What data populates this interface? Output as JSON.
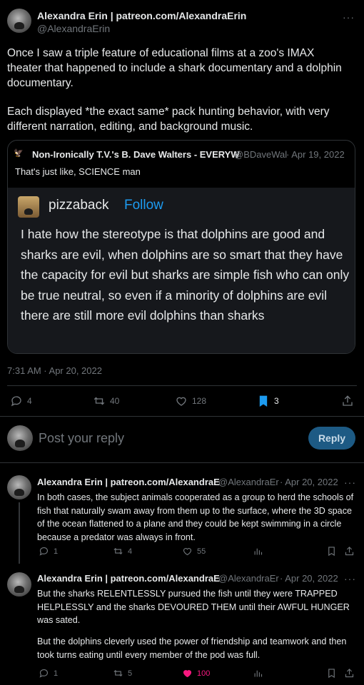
{
  "main_tweet": {
    "author_name": "Alexandra Erin | patreon.com/AlexandraErin",
    "handle": "@AlexandraErin",
    "more": "···",
    "text": "Once I saw a triple feature of educational films at a zoo's IMAX theater that happened to include a shark documentary and a dolphin documentary.",
    "text2": "Each displayed *the exact same* pack hunting behavior, with very different narration, editing, and background music.",
    "timestamp": "7:31 AM · Apr 20, 2022",
    "actions": {
      "replies": "4",
      "retweets": "40",
      "likes": "128",
      "bookmarks": "3"
    }
  },
  "quoted_tweet": {
    "author_name": "Non-Ironically T.V.'s B. Dave Walters - EVERYW",
    "handle": "@BDaveWal",
    "date": "· Apr 19, 2022",
    "text": "That's just like, SCIENCE man",
    "embedded": {
      "name": "pizzaback",
      "follow": "Follow",
      "text": "I hate how the stereotype is that dolphins are good and sharks are evil, when dolphins are so smart that they have the capacity for evil but sharks are simple fish who can only be true neutral, so even if a minority of dolphins are evil there are still more evil dolphins than sharks"
    }
  },
  "composer": {
    "placeholder": "Post your reply",
    "button": "Reply"
  },
  "replies": [
    {
      "author_name": "Alexandra Erin | patreon.com/AlexandraE",
      "handle": "@AlexandraEr",
      "date": "· Apr 20, 2022",
      "more": "···",
      "text": "In both cases, the subject animals cooperated as a group to herd the schools of fish that naturally swam away from them up to the surface, where the 3D space of the ocean flattened to a plane and they could be kept swimming in a circle because a predator was always in front.",
      "actions": {
        "replies": "1",
        "retweets": "4",
        "likes": "55"
      }
    },
    {
      "author_name": "Alexandra Erin | patreon.com/AlexandraE",
      "handle": "@AlexandraEr",
      "date": "· Apr 20, 2022",
      "more": "···",
      "text": "But the sharks RELENTLESSLY pursued the fish until they were TRAPPED HELPLESSLY and the sharks DEVOURED THEM until their AWFUL HUNGER was sated.",
      "text2": "But the dolphins cleverly used the power of friendship and teamwork and then took turns eating until every member of the pod was full.",
      "actions": {
        "replies": "1",
        "retweets": "5",
        "likes": "100"
      }
    }
  ],
  "colors": {
    "accent": "#1d9bf0",
    "like_active": "#f91880",
    "background": "#000000"
  }
}
